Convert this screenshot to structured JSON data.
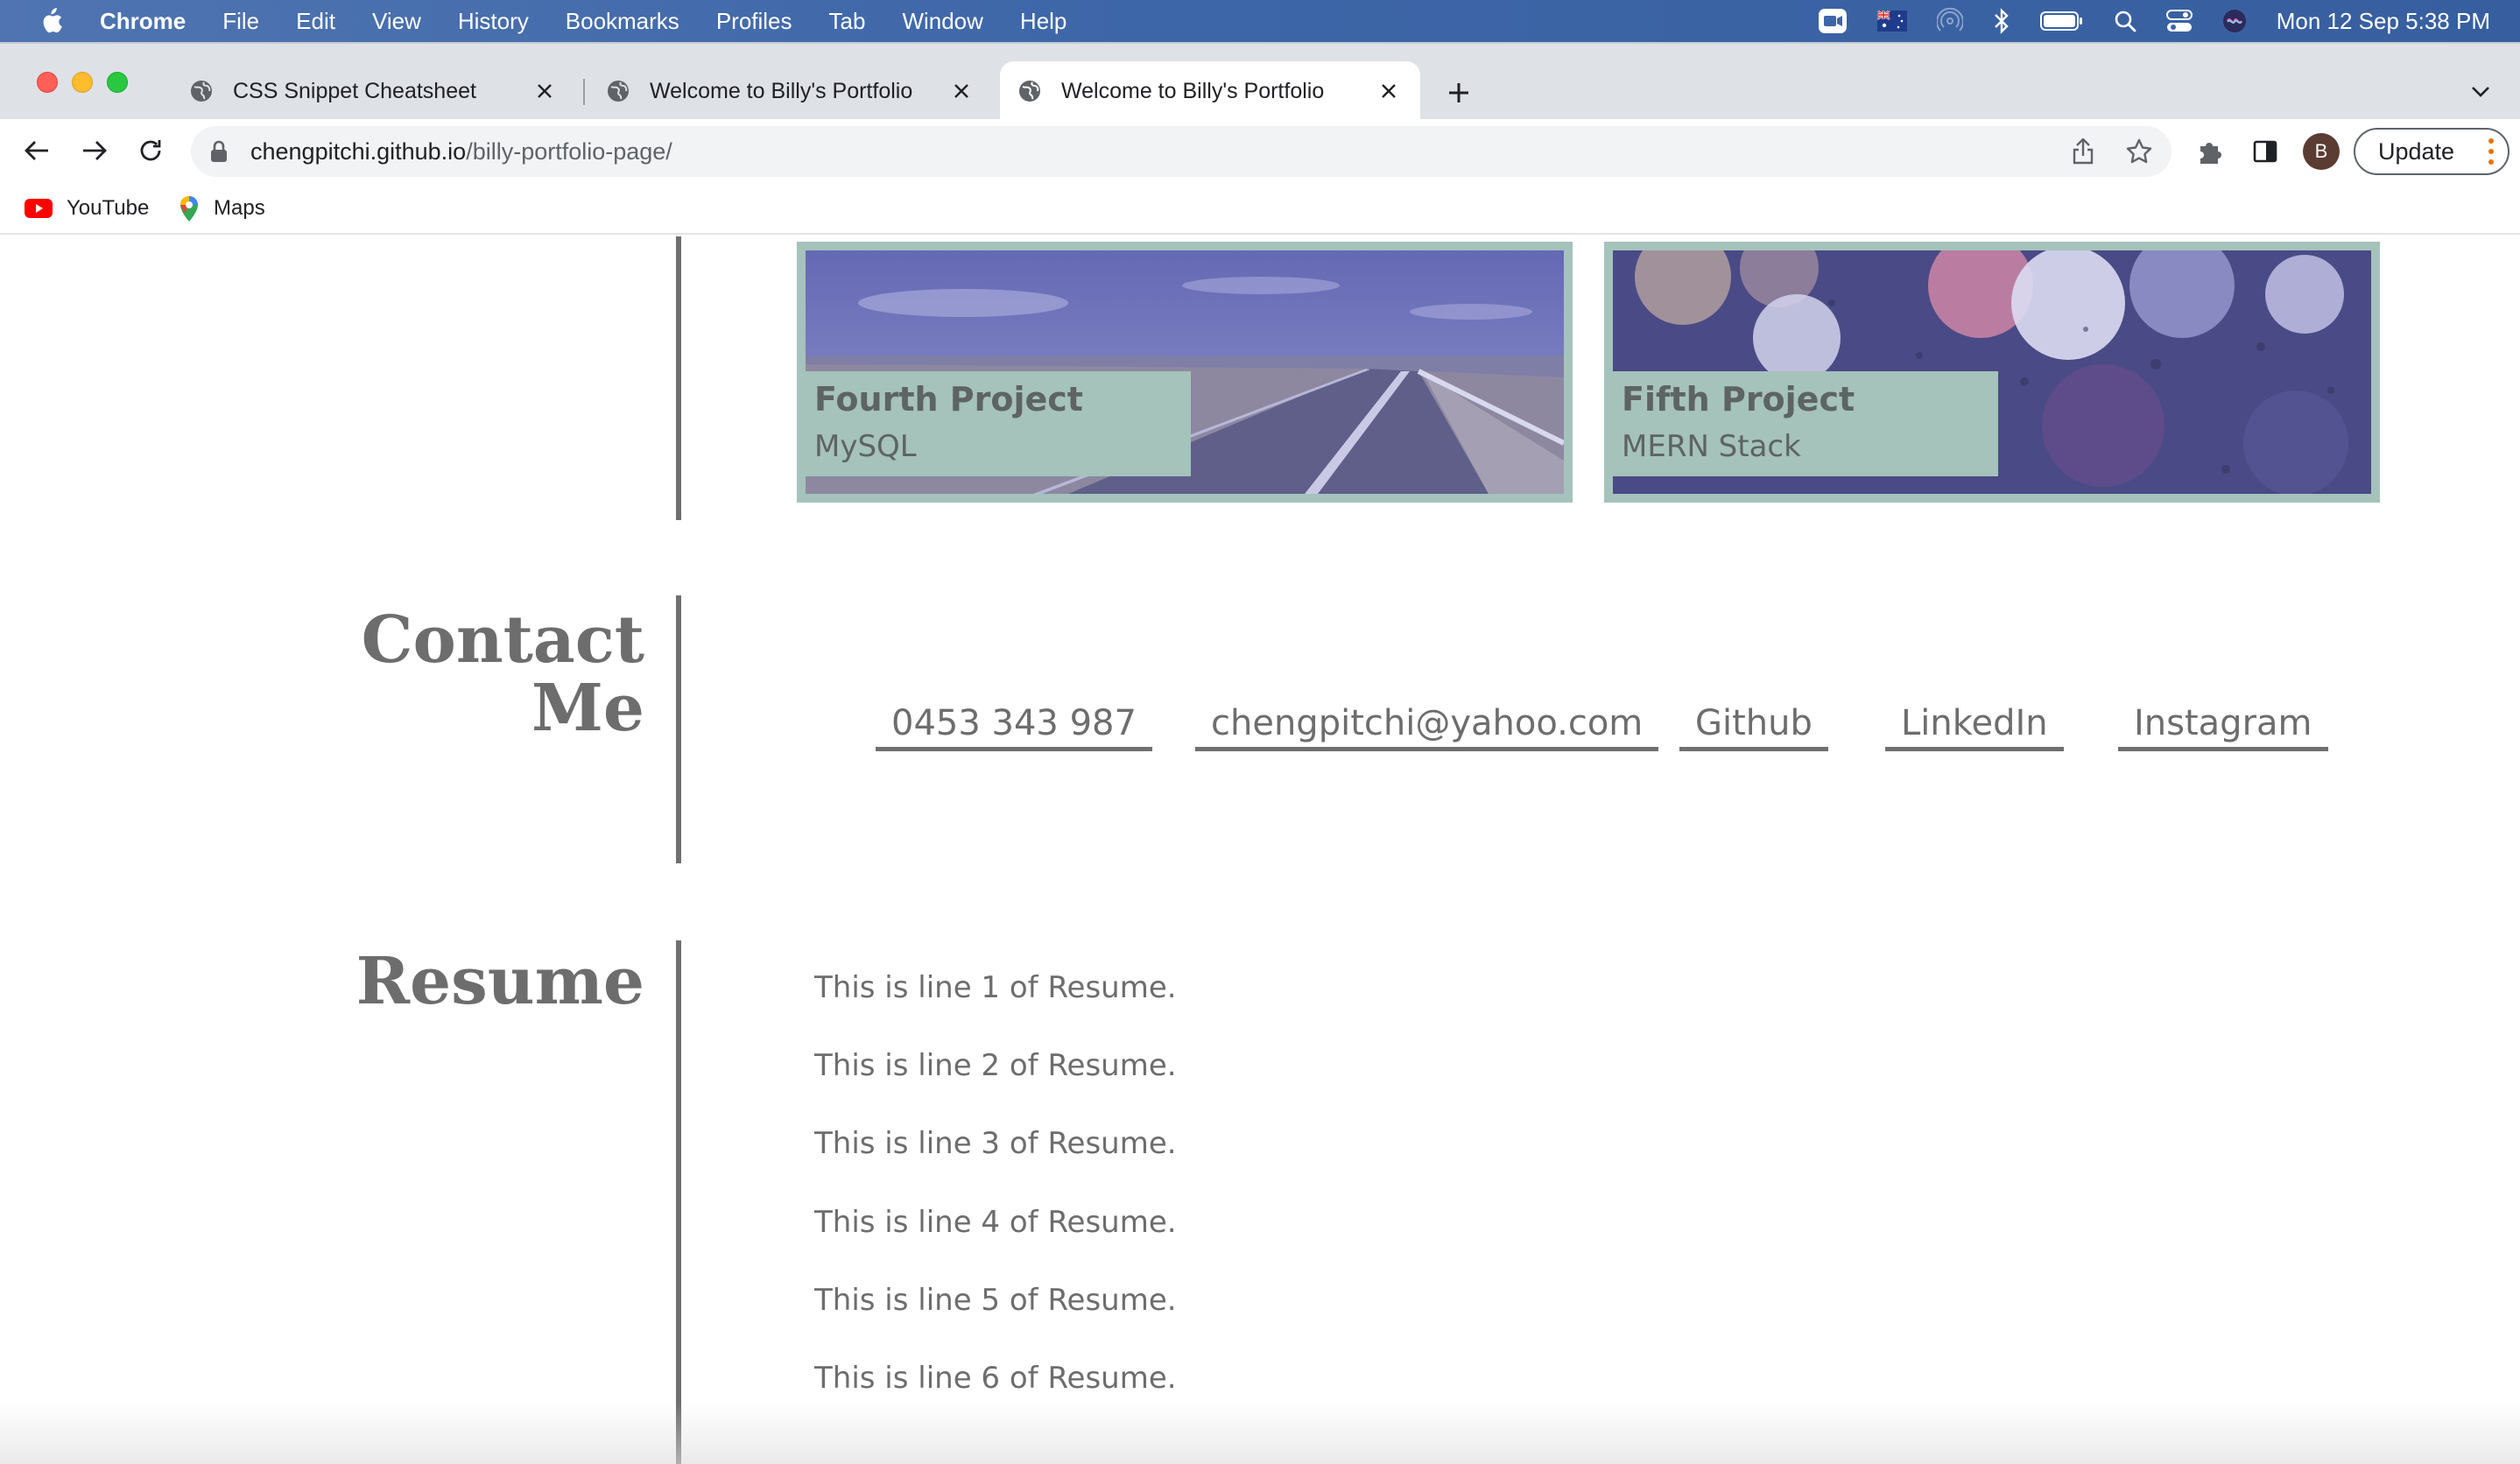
{
  "menubar": {
    "app_name": "Chrome",
    "items": [
      "File",
      "Edit",
      "View",
      "History",
      "Bookmarks",
      "Profiles",
      "Tab",
      "Window",
      "Help"
    ],
    "clock": "Mon 12 Sep  5:38 PM",
    "status_icons": [
      "zoom-icon",
      "flag-icon",
      "airdrop-icon",
      "bluetooth-icon",
      "battery-icon",
      "spotlight-icon",
      "control-center-icon",
      "siri-icon"
    ]
  },
  "tabs": [
    {
      "title": "CSS Snippet Cheatsheet",
      "active": false
    },
    {
      "title": "Welcome to Billy's Portfolio",
      "active": false
    },
    {
      "title": "Welcome to Billy's Portfolio",
      "active": true
    }
  ],
  "toolbar": {
    "url_host": "chengpitchi.github.io",
    "url_path": "/billy-portfolio-page/",
    "avatar_initial": "B",
    "update_label": "Update"
  },
  "bookmarks": [
    {
      "label": "YouTube",
      "icon": "youtube-icon"
    },
    {
      "label": "Maps",
      "icon": "maps-icon"
    }
  ],
  "projects": [
    {
      "title": "Fourth Project",
      "subtitle": "MySQL",
      "image": "road-landscape"
    },
    {
      "title": "Fifth Project",
      "subtitle": "MERN Stack",
      "image": "bokeh-raindrops"
    }
  ],
  "contact": {
    "title_line1": "Contact",
    "title_line2": "Me",
    "links": [
      "0453 343 987",
      "chengpitchi@yahoo.com",
      "Github",
      "LinkedIn",
      "Instagram"
    ]
  },
  "resume": {
    "title": "Resume",
    "lines": [
      "This is line 1 of Resume.",
      "This is line 2 of Resume.",
      "This is line 3 of Resume.",
      "This is line 4 of Resume.",
      "This is line 5 of Resume.",
      "This is line 6 of Resume."
    ]
  },
  "colors": {
    "menubar": "#3d66a8",
    "card_teal": "#a5c2bb",
    "text_gray": "#6d6d6d",
    "image_tint": "#5a5fa8"
  }
}
